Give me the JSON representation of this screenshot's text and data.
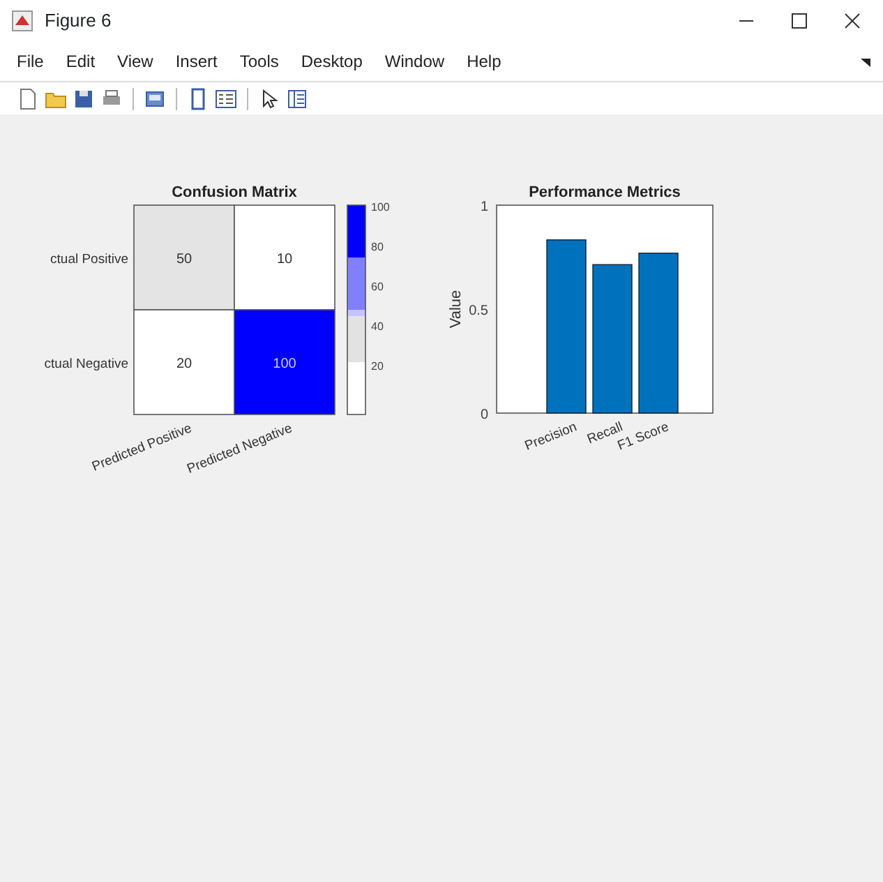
{
  "window": {
    "title": "Figure 6"
  },
  "menu": [
    "File",
    "Edit",
    "View",
    "Insert",
    "Tools",
    "Desktop",
    "Window",
    "Help"
  ],
  "confusion_matrix": {
    "title": "Confusion Matrix",
    "row_labels": [
      "ctual Positive",
      "ctual Negative"
    ],
    "column_labels": [
      "Predicted Positive",
      "Predicted Negative"
    ],
    "cells": [
      [
        {
          "value": "50",
          "color": "#e4e4e4"
        },
        {
          "value": "10",
          "color": "#ffffff"
        }
      ],
      [
        {
          "value": "20",
          "color": "#ffffff"
        },
        {
          "value": "100",
          "color": "#0000ff"
        }
      ]
    ],
    "colorbar": {
      "ticks": [
        "100",
        "80",
        "60",
        "40",
        "20"
      ],
      "segments": [
        {
          "color": "#0000ff"
        },
        {
          "color": "#8080ff"
        },
        {
          "color": "#c4c4ff"
        },
        {
          "color": "#e2e2e2"
        },
        {
          "color": "#ffffff"
        }
      ]
    }
  },
  "performance_chart": {
    "chart_data": {
      "type": "bar",
      "title": "Performance Metrics",
      "ylabel": "Value",
      "categories": [
        "Precision",
        "Recall",
        "F1 Score"
      ],
      "series": [
        {
          "color": "#0072bd",
          "values": [
            0.833,
            0.714,
            0.769
          ]
        }
      ],
      "ylim": [
        0,
        1
      ],
      "yticks": [
        0,
        {
          "value": 0.5,
          "label": "0.5"
        },
        1
      ]
    }
  }
}
